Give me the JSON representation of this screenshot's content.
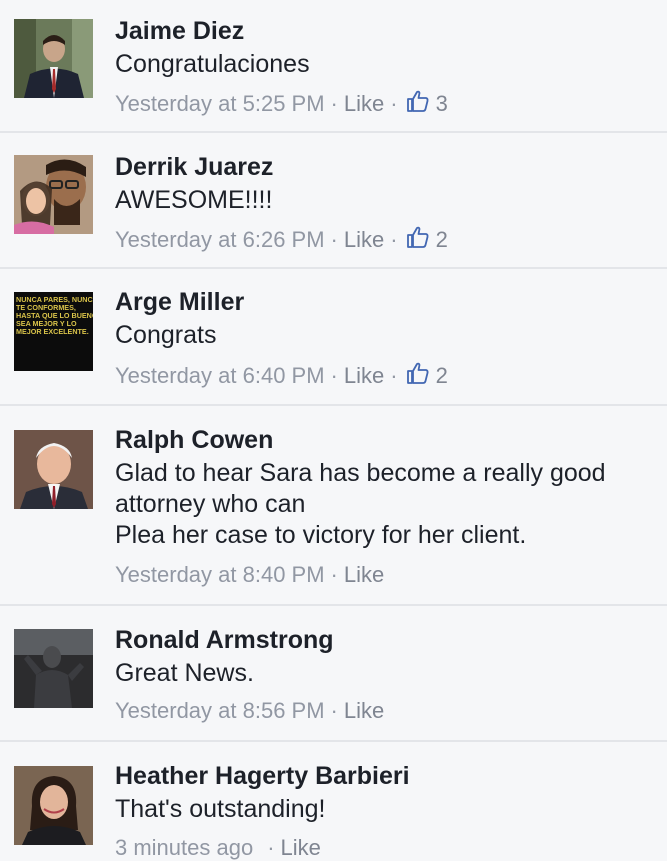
{
  "comments": [
    {
      "author": "Jaime Diez",
      "text": "Congratulaciones",
      "timestamp": "Yesterday at 5:25 PM",
      "like_label": "Like",
      "likes": "3",
      "avatar_icon": "man-in-suit-portrait"
    },
    {
      "author": "Derrik Juarez",
      "text": "AWESOME!!!!",
      "timestamp": "Yesterday at 6:26 PM",
      "like_label": "Like",
      "likes": "2",
      "avatar_icon": "father-daughter-selfie"
    },
    {
      "author": "Arge Miller",
      "text": "Congrats",
      "timestamp": "Yesterday at 6:40 PM",
      "like_label": "Like",
      "likes": "2",
      "avatar_icon": "quote-poster",
      "avatar_text": "NUNCA PARES, NUNCA TE CONFORMES, HASTA QUE LO BUENO SEA MEJOR Y LO MEJOR EXCELENTE."
    },
    {
      "author": "Ralph Cowen",
      "text": "Glad to hear Sara has become a really good\nattorney who can\nPlea her case to victory for her client.",
      "timestamp": "Yesterday at 8:40 PM",
      "like_label": "Like",
      "avatar_icon": "older-man-portrait"
    },
    {
      "author": "Ronald Armstrong",
      "text": "Great News.",
      "timestamp": "Yesterday at 8:56 PM",
      "like_label": "Like",
      "avatar_icon": "statue-photo"
    },
    {
      "author": "Heather Hagerty Barbieri",
      "text": "That's outstanding!",
      "timestamp": "3 minutes ago",
      "like_label": "Like",
      "avatar_icon": "woman-portrait"
    }
  ],
  "colors": {
    "background": "#f6f7f9",
    "text": "#1d2129",
    "meta": "#9197a3",
    "like_icon": "#4267b2"
  },
  "icons": {
    "like": "thumbs-up-icon"
  }
}
